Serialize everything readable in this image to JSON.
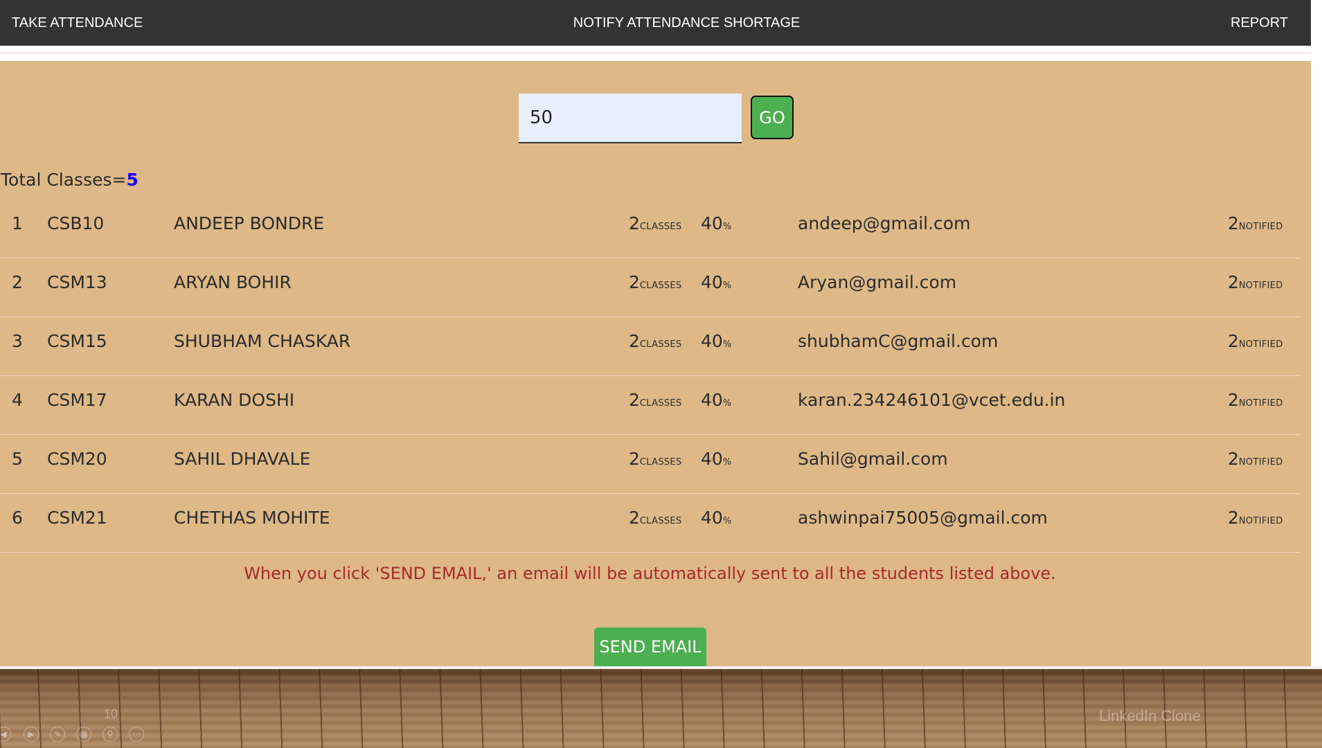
{
  "nav": {
    "take_attendance": "TAKE ATTENDANCE",
    "notify_shortage": "NOTIFY ATTENDANCE SHORTAGE",
    "report": "REPORT"
  },
  "filter": {
    "value": "50",
    "go_label": "GO"
  },
  "summary": {
    "label": "Total Classes=",
    "value": "5"
  },
  "students": [
    {
      "idx": "1",
      "roll": "CSB10",
      "name": "ANDEEP BONDRE",
      "classes": "2",
      "percent": "40",
      "email": "andeep@gmail.com",
      "notified": "2"
    },
    {
      "idx": "2",
      "roll": "CSM13",
      "name": "ARYAN BOHIR",
      "classes": "2",
      "percent": "40",
      "email": "Aryan@gmail.com",
      "notified": "2"
    },
    {
      "idx": "3",
      "roll": "CSM15",
      "name": "SHUBHAM CHASKAR",
      "classes": "2",
      "percent": "40",
      "email": "shubhamC@gmail.com",
      "notified": "2"
    },
    {
      "idx": "4",
      "roll": "CSM17",
      "name": "KARAN DOSHI",
      "classes": "2",
      "percent": "40",
      "email": "karan.234246101@vcet.edu.in",
      "notified": "2"
    },
    {
      "idx": "5",
      "roll": "CSM20",
      "name": "SAHIL DHAVALE",
      "classes": "2",
      "percent": "40",
      "email": "Sahil@gmail.com",
      "notified": "2"
    },
    {
      "idx": "6",
      "roll": "CSM21",
      "name": "CHETHAS MOHITE",
      "classes": "2",
      "percent": "40",
      "email": "ashwinpai75005@gmail.com",
      "notified": "2"
    }
  ],
  "units": {
    "classes": "CLASSES",
    "percent": "%",
    "notified": "NOTIFIED"
  },
  "notice": "When you click 'SEND EMAIL,' an email will be automatically sent to all the students listed above.",
  "send_button": "SEND EMAIL",
  "slideshow": {
    "slide_number": "10",
    "footer": "LinkedIn Clone",
    "controls": [
      "previous-icon",
      "next-icon",
      "pen-icon",
      "slides-icon",
      "zoom-icon",
      "more-icon"
    ]
  },
  "colors": {
    "nav_bg": "#333333",
    "panel_bg": "#deb887",
    "button_green": "#4caf50",
    "notice_text": "#a52a2a",
    "total_value": "#1a00ff"
  }
}
